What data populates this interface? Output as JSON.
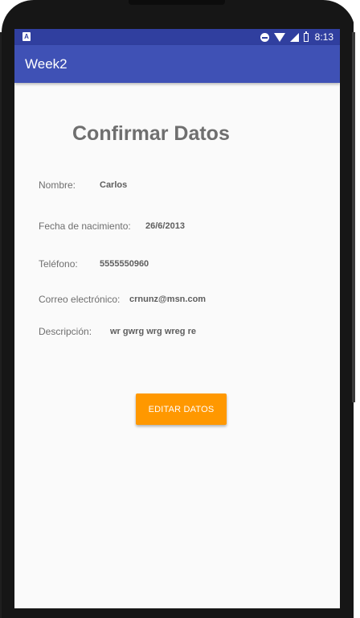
{
  "status_bar": {
    "notification_icon": "A",
    "time": "8:13",
    "icons": [
      "do-not-disturb-icon",
      "wifi-icon",
      "signal-icon",
      "battery-charging-icon"
    ]
  },
  "app_bar": {
    "title": "Week2"
  },
  "page": {
    "title": "Confirmar Datos"
  },
  "fields": {
    "nombre": {
      "label": "Nombre:",
      "value": "Carlos"
    },
    "fecha": {
      "label": "Fecha de nacimiento:",
      "value": "26/6/2013"
    },
    "telefono": {
      "label": "Teléfono:",
      "value": "5555550960"
    },
    "correo": {
      "label": "Correo electrónico:",
      "value": "crnunz@msn.com"
    },
    "descripcion": {
      "label": "Descripción:",
      "value": "wr gwrg wrg wreg re"
    }
  },
  "actions": {
    "edit_label": "EDITAR DATOS"
  },
  "colors": {
    "status_bar": "#303f9f",
    "app_bar": "#3f51b5",
    "button": "#ff9800",
    "background": "#fafafa"
  }
}
